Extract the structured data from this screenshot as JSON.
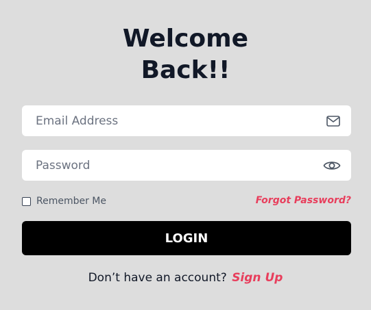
{
  "heading": {
    "line1": "Welcome",
    "line2": "Back!!"
  },
  "email": {
    "placeholder": "Email Address",
    "value": "",
    "icon": "mail-icon"
  },
  "password": {
    "placeholder": "Password",
    "value": "",
    "icon": "eye-icon"
  },
  "remember": {
    "label": "Remember Me",
    "checked": false
  },
  "forgot": {
    "label": "Forgot Password?"
  },
  "login": {
    "label": "LOGIN"
  },
  "signup": {
    "prompt": "Don’t have an account?",
    "link_label": "Sign Up"
  },
  "colors": {
    "background": "#dddddd",
    "accent": "#e83e5c",
    "button": "#000000",
    "heading": "#111827"
  }
}
